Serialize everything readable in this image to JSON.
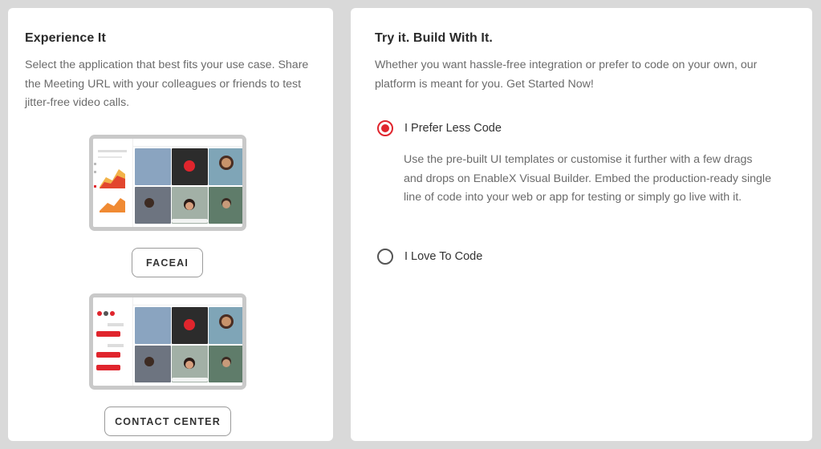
{
  "left": {
    "heading": "Experience It",
    "description": "Select the application that best fits your use case. Share the Meeting URL with your colleagues or friends to test jitter-free video calls.",
    "faceai_button": "FACEAI",
    "contact_button": "CONTACT CENTER"
  },
  "right": {
    "heading": "Try it. Build With It.",
    "description": "Whether you want hassle-free integration or prefer to code on your own, our platform is meant for you. Get Started Now!",
    "options": [
      {
        "label": "I Prefer Less Code",
        "checked": true,
        "description": "Use the pre-built UI templates or customise it further with a few drags and drops on EnableX Visual Builder. Embed the production-ready single line of code into your web or app for testing or simply go live with it."
      },
      {
        "label": "I Love To Code",
        "checked": false
      }
    ]
  },
  "colors": {
    "accent": "#e0252d",
    "background": "#d9d9d9",
    "panel": "#ffffff",
    "text_muted": "#6b6b6b"
  }
}
